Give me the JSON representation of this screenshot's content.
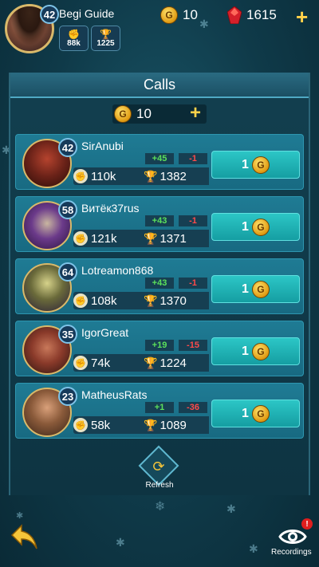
{
  "player": {
    "name": "Begi Guide",
    "level": "42",
    "power": "88k",
    "trophies": "1225"
  },
  "currencies": {
    "coins": "10",
    "gems": "1615"
  },
  "panel": {
    "title": "Calls",
    "calls_count": "10"
  },
  "opponents": [
    {
      "name": "SirAnubi",
      "level": "42",
      "power": "110k",
      "gain": "+45",
      "loss": "-1",
      "trophies": "1382",
      "cost": "1"
    },
    {
      "name": "Витёк37rus",
      "level": "58",
      "power": "121k",
      "gain": "+43",
      "loss": "-1",
      "trophies": "1371",
      "cost": "1"
    },
    {
      "name": "Lotreamon868",
      "level": "64",
      "power": "108k",
      "gain": "+43",
      "loss": "-1",
      "trophies": "1370",
      "cost": "1"
    },
    {
      "name": "IgorGreat",
      "level": "35",
      "power": "74k",
      "gain": "+19",
      "loss": "-15",
      "trophies": "1224",
      "cost": "1"
    },
    {
      "name": "MatheusRats",
      "level": "23",
      "power": "58k",
      "gain": "+1",
      "loss": "-36",
      "trophies": "1089",
      "cost": "1"
    }
  ],
  "footer": {
    "refresh_label": "Refresh",
    "recordings_label": "Recordings",
    "recordings_badge": "!"
  },
  "colors": {
    "accent": "#ffd24a",
    "gain": "#5be05b",
    "loss": "#ff4a4a",
    "button": "#2cc6c6"
  }
}
